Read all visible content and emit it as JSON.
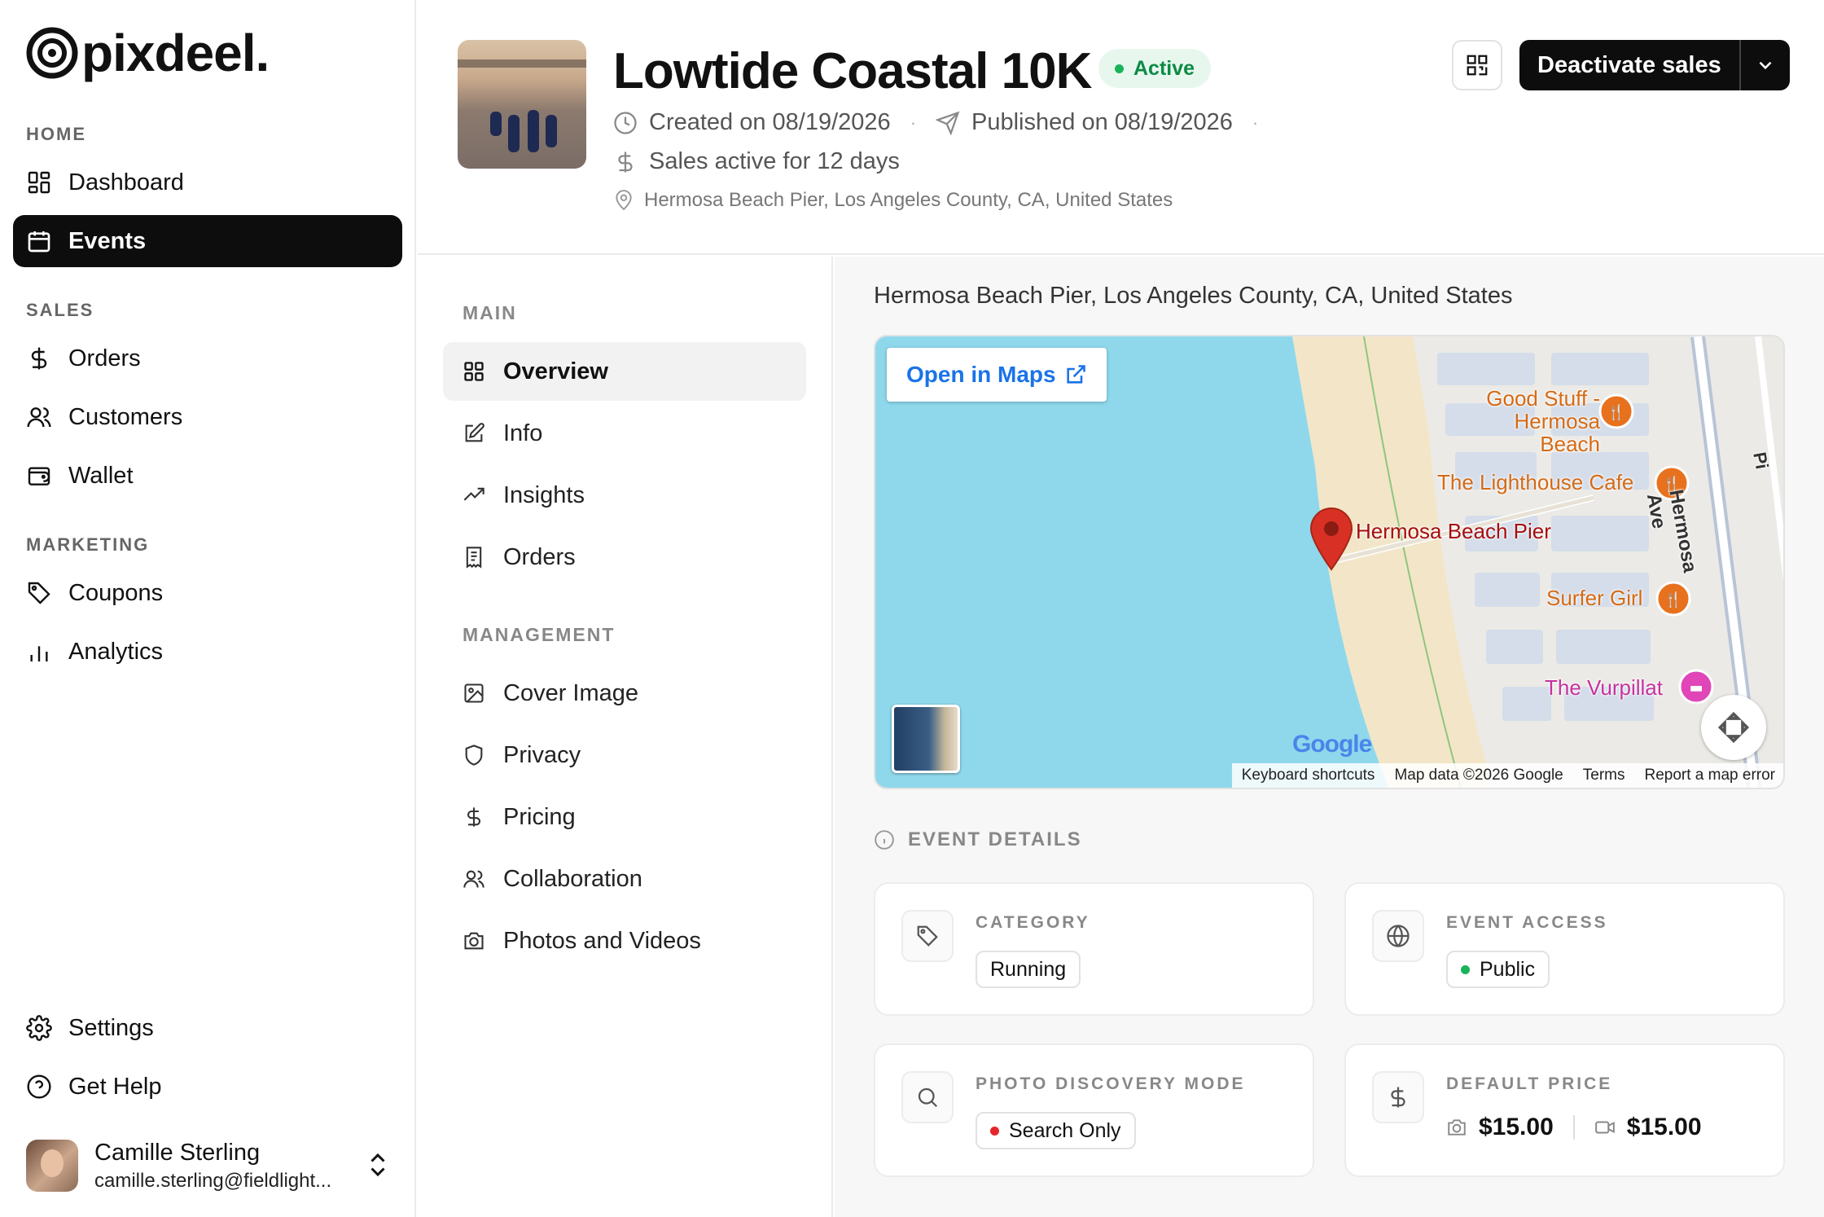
{
  "brand": {
    "name": "pixdeel."
  },
  "sidebar": {
    "sections": [
      {
        "title": "HOME"
      },
      {
        "title": "SALES"
      },
      {
        "title": "MARKETING"
      }
    ],
    "items": {
      "dashboard": "Dashboard",
      "events": "Events",
      "orders": "Orders",
      "customers": "Customers",
      "wallet": "Wallet",
      "coupons": "Coupons",
      "analytics": "Analytics",
      "settings": "Settings",
      "help": "Get Help"
    },
    "user": {
      "name": "Camille Sterling",
      "email": "camille.sterling@fieldlight..."
    }
  },
  "event": {
    "title": "Lowtide Coastal 10K",
    "status": "Active",
    "created": "Created on 08/19/2026",
    "published": "Published on 08/19/2026",
    "separator": "·",
    "sales_active": "Sales active for 12 days",
    "location": "Hermosa Beach Pier, Los Angeles County, CA, United States"
  },
  "header_actions": {
    "deactivate_label": "Deactivate sales"
  },
  "subnav": {
    "main_title": "MAIN",
    "management_title": "MANAGEMENT",
    "items": {
      "overview": "Overview",
      "info": "Info",
      "insights": "Insights",
      "orders": "Orders",
      "cover": "Cover Image",
      "privacy": "Privacy",
      "pricing": "Pricing",
      "collaboration": "Collaboration",
      "photos": "Photos and Videos"
    }
  },
  "map": {
    "caption": "Hermosa Beach Pier, Los Angeles County, CA, United States",
    "open_label": "Open in Maps",
    "places": {
      "good_stuff_1": "Good Stuff -",
      "good_stuff_2": "Hermosa Beach",
      "lighthouse": "The Lighthouse Cafe",
      "pier": "Hermosa Beach Pier",
      "surfer": "Surfer Girl",
      "vurpillat": "The Vurpillat",
      "street": "Hermosa Ave",
      "street_partial": "Pi"
    },
    "google": "Google",
    "attribution": {
      "shortcuts": "Keyboard shortcuts",
      "data": "Map data ©2026 Google",
      "terms": "Terms",
      "report": "Report a map error"
    },
    "colors": {
      "water": "#8fd8ec",
      "sand": "#f3e6c8",
      "poi": "#e8711d",
      "pin": "#d93025",
      "lodging": "#e046b8"
    }
  },
  "details": {
    "heading": "EVENT DETAILS",
    "category": {
      "label": "CATEGORY",
      "value": "Running"
    },
    "access": {
      "label": "EVENT ACCESS",
      "value": "Public",
      "dot_color": "#19b35a"
    },
    "discovery": {
      "label": "PHOTO DISCOVERY MODE",
      "value": "Search Only",
      "dot_color": "#e5262b"
    },
    "price": {
      "label": "DEFAULT PRICE",
      "photo": "$15.00",
      "video": "$15.00"
    }
  }
}
